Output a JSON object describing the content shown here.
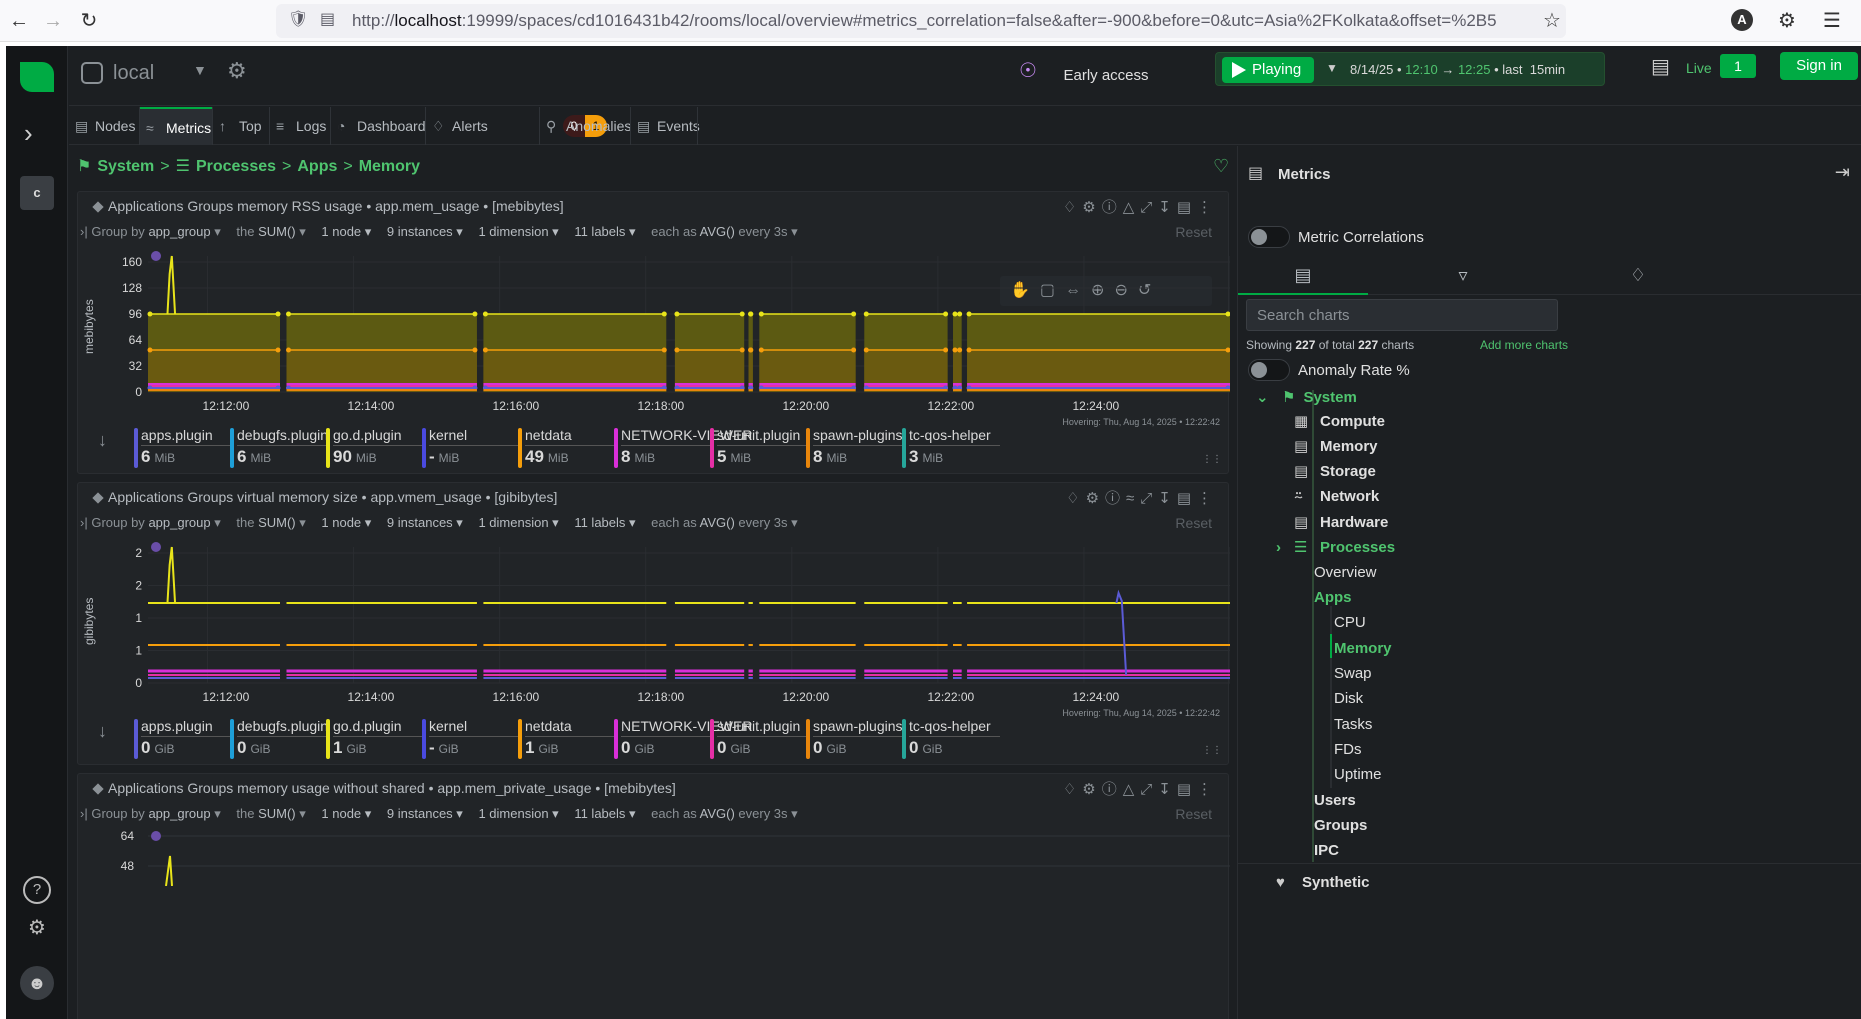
{
  "browser": {
    "url_prefix": "http://",
    "url_host": "localhost",
    "url_rest": ":19999/spaces/cd1016431b42/rooms/local/overview#metrics_correlation=false&after=-900&before=0&utc=Asia%2FKolkata&offset=%2B5",
    "profile_letter": "A"
  },
  "topbar": {
    "space": "local",
    "early_access": "Early access",
    "playing": "Playing",
    "date": "8/14/25",
    "time_from": "12:10",
    "time_to": "12:25",
    "last": "last",
    "last_value": "15min",
    "live": "Live",
    "live_count": "1",
    "sign_in": "Sign in"
  },
  "rail": {
    "space_letter": "c"
  },
  "tabs": [
    {
      "label": "Nodes"
    },
    {
      "label": "Metrics"
    },
    {
      "label": "Top"
    },
    {
      "label": "Logs"
    },
    {
      "label": "Dashboard"
    },
    {
      "label": "Alerts"
    },
    {
      "label": "Anomalies"
    },
    {
      "label": "Events"
    }
  ],
  "alerts": {
    "critical": "0",
    "warning": "1"
  },
  "breadcrumb": [
    "System",
    "Processes",
    "Apps",
    "Memory"
  ],
  "common": {
    "group_by": "Group by",
    "group_value": "app_group",
    "the": "the",
    "agg": "SUM()",
    "nodes": "1 node",
    "instances": "9 instances",
    "dimensions": "1 dimension",
    "labels": "11 labels",
    "each_as": "each as",
    "each_agg": "AVG()",
    "every": "every 3s",
    "reset": "Reset",
    "hovering": "Hovering:  Thu, Aug 14, 2025 • 12:22:42"
  },
  "charts": [
    {
      "title": "Applications Groups memory RSS usage • app.mem_usage • [mebibytes]",
      "ylabel": "mebibytes",
      "yticks": [
        "160",
        "128",
        "96",
        "64",
        "32",
        "0"
      ],
      "xticks": [
        "12:12:00",
        "12:14:00",
        "12:16:00",
        "12:18:00",
        "12:20:00",
        "12:22:00",
        "12:24:00"
      ],
      "legend": [
        {
          "name": "apps.plugin",
          "value": "6",
          "unit": "MiB",
          "color": "#5b5bd6"
        },
        {
          "name": "debugfs.plugin",
          "value": "6",
          "unit": "MiB",
          "color": "#1e9fd8"
        },
        {
          "name": "go.d.plugin",
          "value": "90",
          "unit": "MiB",
          "color": "#e8e41a"
        },
        {
          "name": "kernel",
          "value": "-",
          "unit": "MiB",
          "color": "#4a4ae0"
        },
        {
          "name": "netdata",
          "value": "49",
          "unit": "MiB",
          "color": "#f59e0b"
        },
        {
          "name": "NETWORK-VIEWER",
          "value": "8",
          "unit": "MiB",
          "color": "#d92fd9"
        },
        {
          "name": "sd-unit.plugin",
          "value": "5",
          "unit": "MiB",
          "color": "#e52fa6"
        },
        {
          "name": "spawn-plugins",
          "value": "8",
          "unit": "MiB",
          "color": "#e8860c"
        },
        {
          "name": "tc-qos-helper",
          "value": "3",
          "unit": "MiB",
          "color": "#26a69a"
        }
      ]
    },
    {
      "title": "Applications Groups virtual memory size • app.vmem_usage • [gibibytes]",
      "ylabel": "gibibytes",
      "yticks": [
        "2",
        "2",
        "1",
        "1",
        "0"
      ],
      "xticks": [
        "12:12:00",
        "12:14:00",
        "12:16:00",
        "12:18:00",
        "12:20:00",
        "12:22:00",
        "12:24:00"
      ],
      "legend": [
        {
          "name": "apps.plugin",
          "value": "0",
          "unit": "GiB",
          "color": "#5b5bd6"
        },
        {
          "name": "debugfs.plugin",
          "value": "0",
          "unit": "GiB",
          "color": "#1e9fd8"
        },
        {
          "name": "go.d.plugin",
          "value": "1",
          "unit": "GiB",
          "color": "#e8e41a"
        },
        {
          "name": "kernel",
          "value": "-",
          "unit": "GiB",
          "color": "#4a4ae0"
        },
        {
          "name": "netdata",
          "value": "1",
          "unit": "GiB",
          "color": "#f59e0b"
        },
        {
          "name": "NETWORK-VIEWER",
          "value": "0",
          "unit": "GiB",
          "color": "#d92fd9"
        },
        {
          "name": "sd-unit.plugin",
          "value": "0",
          "unit": "GiB",
          "color": "#e52fa6"
        },
        {
          "name": "spawn-plugins",
          "value": "0",
          "unit": "GiB",
          "color": "#e8860c"
        },
        {
          "name": "tc-qos-helper",
          "value": "0",
          "unit": "GiB",
          "color": "#26a69a"
        }
      ]
    },
    {
      "title": "Applications Groups memory usage without shared • app.mem_private_usage • [mebibytes]",
      "yticks": [
        "64",
        "48"
      ]
    }
  ],
  "sidebar": {
    "title": "Metrics",
    "metric_correlations": "Metric Correlations",
    "search_placeholder": "Search charts",
    "showing_prefix": "Showing",
    "showing_count": "227",
    "showing_mid": "of total",
    "showing_total": "227",
    "showing_suffix": "charts",
    "add_more": "Add more charts",
    "anomaly_rate": "Anomaly Rate %",
    "tree": {
      "system": "System",
      "compute": "Compute",
      "memory": "Memory",
      "storage": "Storage",
      "network": "Network",
      "hardware": "Hardware",
      "processes": "Processes",
      "overview": "Overview",
      "apps": "Apps",
      "cpu": "CPU",
      "app_memory": "Memory",
      "swap": "Swap",
      "disk": "Disk",
      "tasks": "Tasks",
      "fds": "FDs",
      "uptime": "Uptime",
      "users": "Users",
      "groups": "Groups",
      "ipc": "IPC",
      "synthetic": "Synthetic"
    }
  }
}
